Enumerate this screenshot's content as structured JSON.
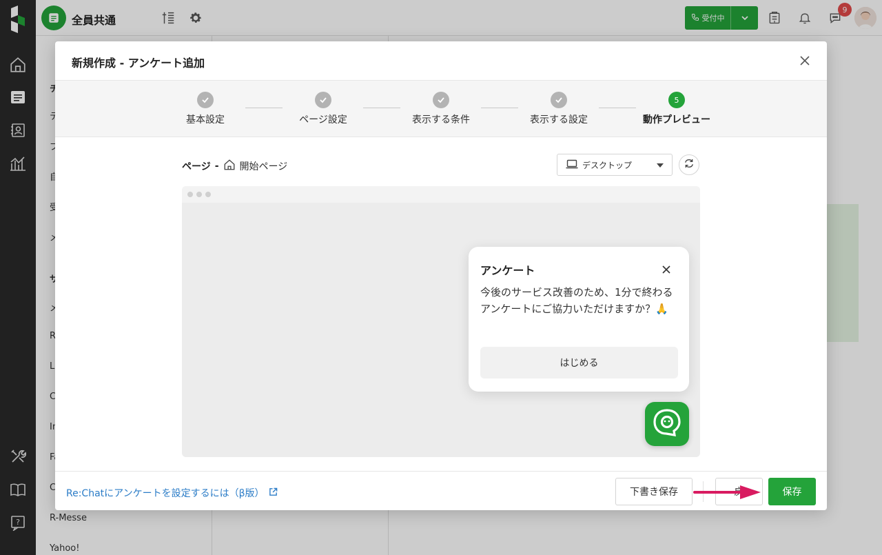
{
  "header": {
    "workspace_name": "全員共通",
    "status_label": "受付中",
    "notification_count": "9"
  },
  "colors": {
    "brand_green": "#24a33a",
    "link_blue": "#2b7cc7",
    "badge_red": "#e24a4a",
    "arrow_pink": "#d81b60"
  },
  "background": {
    "left_pane_items": [
      "チ",
      "テ",
      "プ",
      "自",
      "受",
      "メ",
      "サ",
      "メ",
      "R",
      "L",
      "C",
      "In",
      "Fa",
      "C",
      "R-Messe",
      "Yahoo!"
    ]
  },
  "modal": {
    "title": "新規作成 - アンケート追加",
    "steps": [
      {
        "label": "基本設定",
        "state": "done"
      },
      {
        "label": "ページ設定",
        "state": "done"
      },
      {
        "label": "表示する条件",
        "state": "done"
      },
      {
        "label": "表示する設定",
        "state": "done"
      },
      {
        "label": "動作プレビュー",
        "state": "active",
        "number": "5"
      }
    ],
    "breadcrumb": {
      "prefix": "ページ",
      "separator": "-",
      "page_name": "開始ページ"
    },
    "device_select": {
      "selected": "デスクトップ"
    },
    "survey_popup": {
      "title": "アンケート",
      "body": "今後のサービス改善のため、1分で終わるアンケートにご協力いただけますか？🙏",
      "start_button": "はじめる"
    },
    "footer": {
      "help_link": "Re:Chatにアンケートを設定するには（β版）",
      "draft_button": "下書き保存",
      "back_button": "戻",
      "save_button": "保存"
    }
  }
}
